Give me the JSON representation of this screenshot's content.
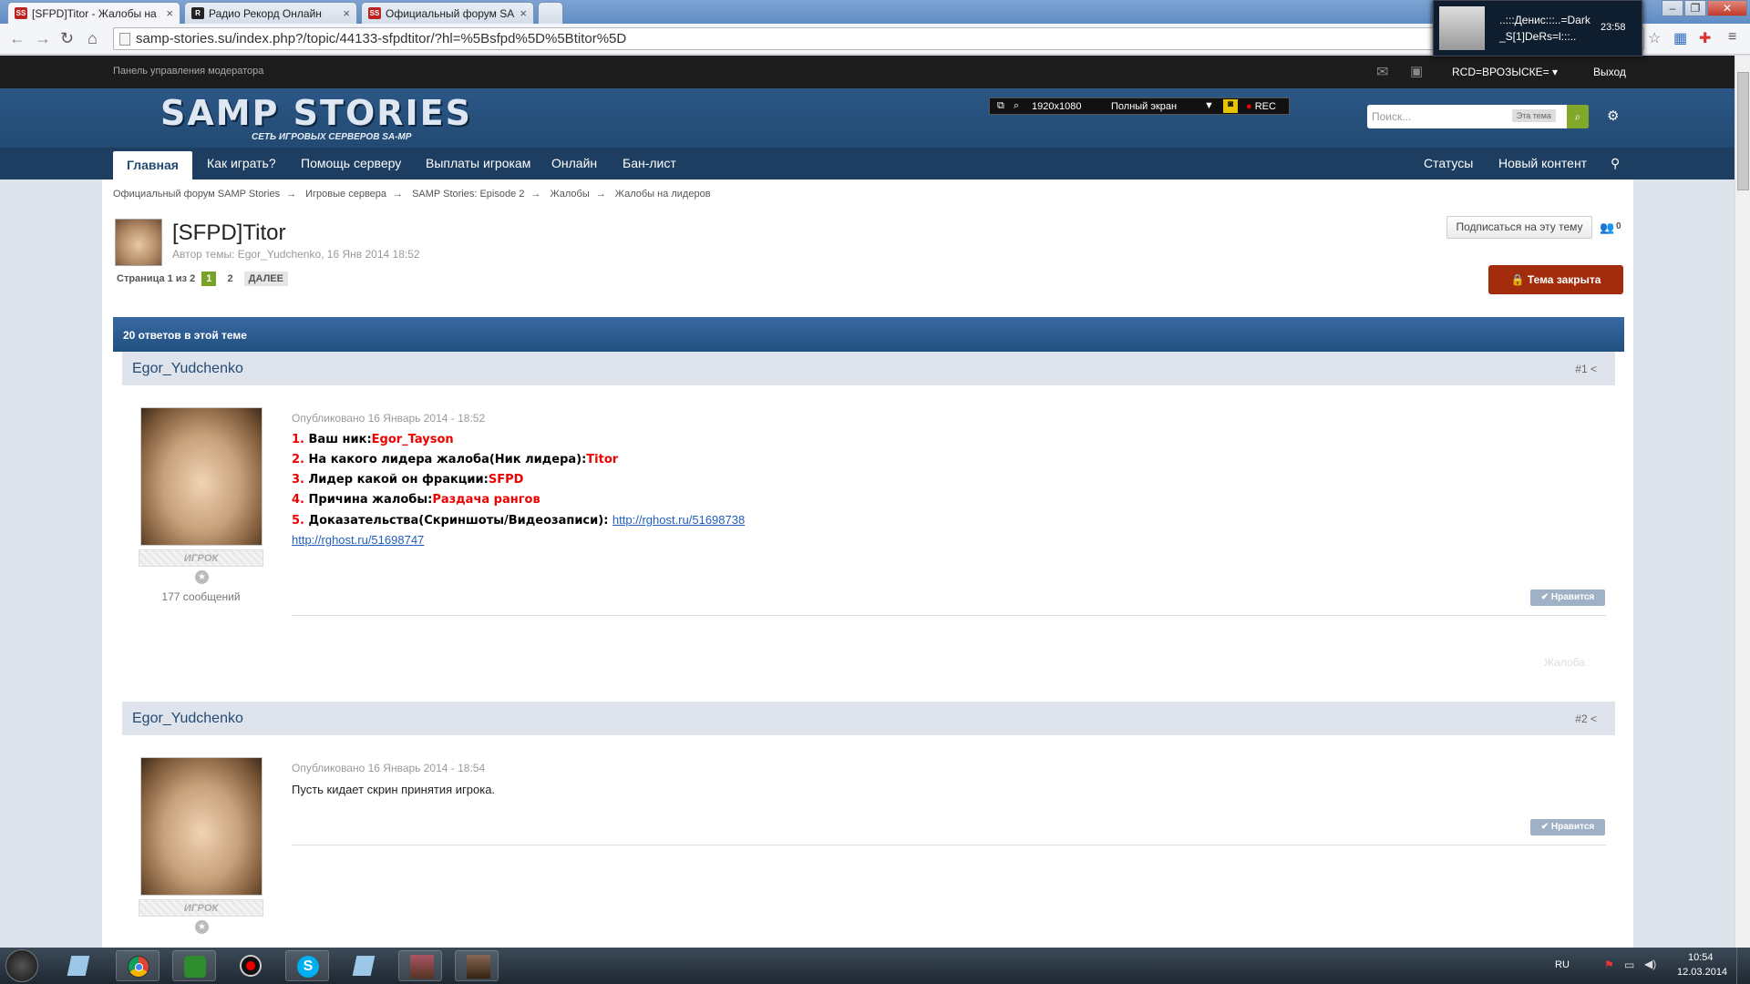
{
  "browser": {
    "tabs": [
      {
        "title": "[SFPD]Titor - Жалобы на",
        "favicon": "SS",
        "active": true
      },
      {
        "title": "Радио Рекорд Онлайн",
        "favicon": "R",
        "active": false
      },
      {
        "title": "Официальный форум SA",
        "favicon": "SS",
        "active": false
      }
    ],
    "url": "samp-stories.su/index.php?/topic/44133-sfpdtitor/?hl=%5Bsfpd%5D%5Btitor%5D"
  },
  "notification": {
    "line1": "..:::Денис:::..=Dark",
    "line2": "_S[1]DeRs=l:::..",
    "time": "23:58"
  },
  "modbar": {
    "label": "Панель управления модератора",
    "user": "RCD=ВРОЗЫСКЕ=",
    "logout": "Выход"
  },
  "header": {
    "logo_title": "SAMP STORIES",
    "logo_tagline": "СЕТЬ ИГРОВЫХ СЕРВЕРОВ SA-MP",
    "rec": {
      "resolution": "1920x1080",
      "mode": "Полный экран",
      "rec": "REC"
    },
    "search_placeholder": "Поиск...",
    "search_scope": "Эта тема"
  },
  "nav": {
    "items": [
      "Главная",
      "Как играть?",
      "Помощь серверу",
      "Выплаты игрокам",
      "Онлайн",
      "Бан-лист"
    ],
    "right": [
      "Статусы",
      "Новый контент"
    ]
  },
  "breadcrumbs": [
    "Официальный форум SAMP Stories",
    "Игровые сервера",
    "SAMP Stories: Episode 2",
    "Жалобы",
    "Жалобы на лидеров"
  ],
  "topic": {
    "title": "[SFPD]Titor",
    "author_line": "Автор темы: Egor_Yudchenko, 16 Янв 2014 18:52",
    "subscribe": "Подписаться на эту тему",
    "followers": "0",
    "pages_label": "Страница 1 из 2",
    "page_current": "1",
    "page_next_num": "2",
    "next_label": "ДАЛЕЕ",
    "closed_label": "Тема закрыта",
    "replies_label": "20 ответов в этой теме"
  },
  "posts": [
    {
      "author": "Egor_Yudchenko",
      "num": "#1",
      "rank": "ИГРОК",
      "count": "177 сообщений",
      "date": "Опубликовано 16 Январь 2014 - 18:52",
      "lines": [
        {
          "n": "1.",
          "q": " Ваш ник:",
          "a": "Egor_Tayson"
        },
        {
          "n": "2.",
          "q": " На какого лидера жалоба(Ник лидера):",
          "a": "Titor"
        },
        {
          "n": "3.",
          "q": " Лидер какой он фракции:",
          "a": "SFPD"
        },
        {
          "n": "4.",
          "q": " Причина жалобы:",
          "a": "Раздача рангов"
        },
        {
          "n": "5.",
          "q": " Доказательства(Скриншоты/Видеозаписи):",
          "a": ""
        }
      ],
      "link1": "http://rghost.ru/51698738",
      "link2": "http://rghost.ru/51698747",
      "like": "Нравится",
      "report": "Жалоба"
    },
    {
      "author": "Egor_Yudchenko",
      "num": "#2",
      "rank": "ИГРОК",
      "date": "Опубликовано 16 Январь 2014 - 18:54",
      "text": "Пусть кидает скрин  принятия игрока.",
      "like": "Нравится"
    }
  ],
  "taskbar": {
    "lang": "RU",
    "time": "10:54",
    "date": "12.03.2014"
  }
}
